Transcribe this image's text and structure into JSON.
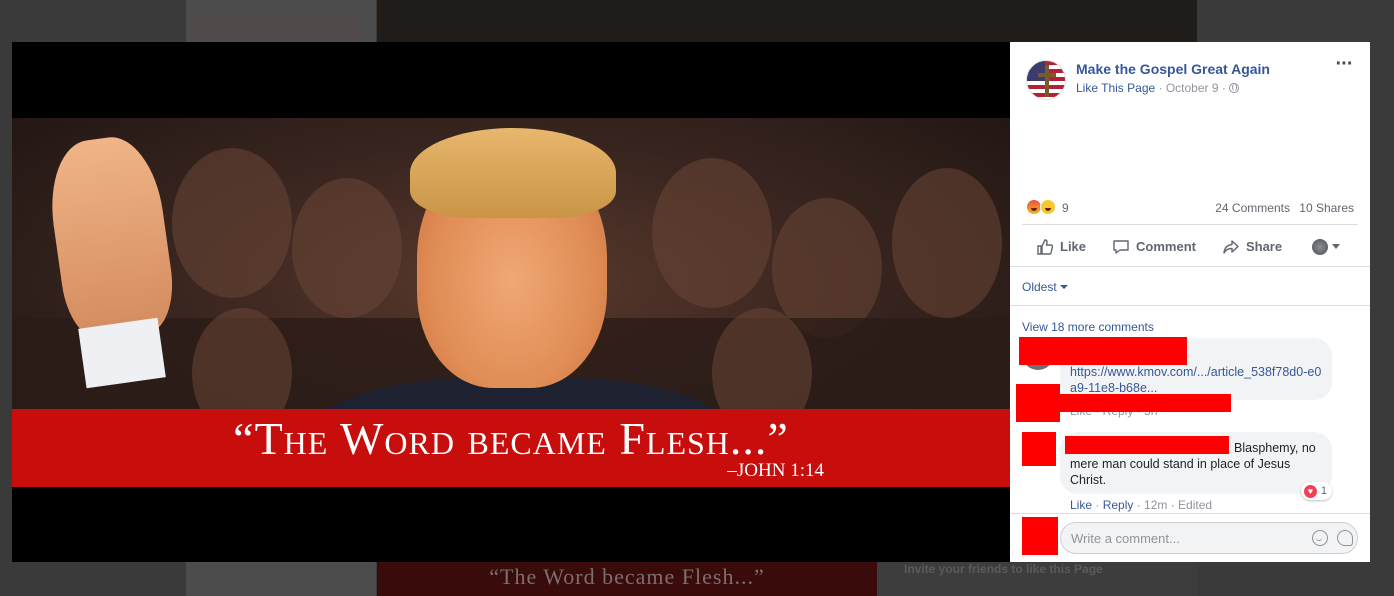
{
  "background_page": {
    "banner_quote": "“The Word became Flesh...”",
    "invite_text": "Invite your friends to like this Page"
  },
  "photo": {
    "quote": "“The Word became Flesh...”",
    "reference": "–JOHN 1:14"
  },
  "post": {
    "page_name": "Make the Gospel Great Again",
    "like_page": "Like This Page",
    "separator": " · ",
    "date": "October 9",
    "reaction_count": "9",
    "comments_count": "24 Comments",
    "shares_count": "10 Shares",
    "actions": {
      "like": "Like",
      "comment": "Comment",
      "share": "Share"
    }
  },
  "comments": {
    "sort_label": "Oldest",
    "view_more": "View 18 more comments",
    "items": [
      {
        "text": "https://www.kmov.com/.../article_538f78d0-e0a9-11e8-b68e...",
        "actions": "Like · Reply · 5h"
      },
      {
        "text": "Blasphemy, no mere man could stand in place of Jesus Christ.",
        "like": "Like",
        "reply": "Reply",
        "meta": "12m · Edited",
        "reaction_count": "1"
      }
    ],
    "write_placeholder": "Write a comment..."
  },
  "colors": {
    "link": "#365899",
    "caption_band": "#c80d0d",
    "redaction": "#ff0000"
  }
}
